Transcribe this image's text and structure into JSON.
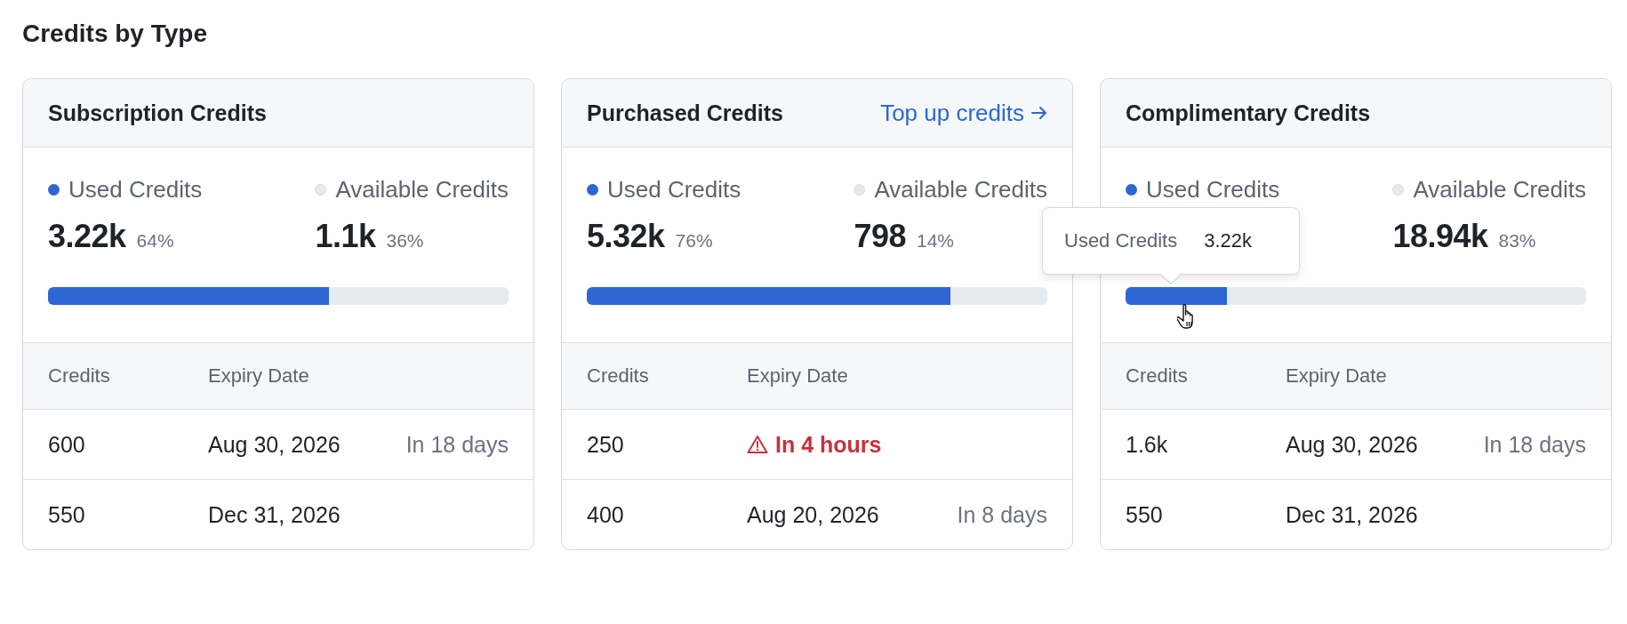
{
  "title": "Credits by Type",
  "cards": [
    {
      "title": "Subscription Credits",
      "used": {
        "label": "Used Credits",
        "value": "3.22k",
        "percent": "64%"
      },
      "available": {
        "label": "Available Credits",
        "value": "1.1k",
        "percent": "36%"
      },
      "level": 0.61,
      "columns": [
        "Credits",
        "Expiry Date"
      ],
      "rows": [
        {
          "credits": "600",
          "expiry": "Aug 30, 2026",
          "urgent": false,
          "relative": "In 18 days"
        },
        {
          "credits": "550",
          "expiry": "Dec 31, 2026",
          "urgent": false
        }
      ]
    },
    {
      "title": "Purchased Credits",
      "link": "Top up credits",
      "used": {
        "label": "Used Credits",
        "value": "5.32k",
        "percent": "76%"
      },
      "available": {
        "label": "Available Credits",
        "value": "798",
        "percent": "14%"
      },
      "level": 0.79,
      "columns": [
        "Credits",
        "Expiry Date"
      ],
      "rows": [
        {
          "credits": "250",
          "expiry": "In 4 hours",
          "urgent": true
        },
        {
          "credits": "400",
          "expiry": "Aug 20, 2026",
          "urgent": false,
          "relative": "In 8 days"
        }
      ]
    },
    {
      "title": "Complimentary Credits",
      "used": {
        "label": "Used Credits"
      },
      "available": {
        "label": "Available Credits",
        "value": "18.94k",
        "percent": "83%"
      },
      "level": 0.22,
      "tooltip": {
        "label": "Used Credits",
        "value": "3.22k"
      },
      "columns": [
        "Credits",
        "Expiry Date"
      ],
      "rows": [
        {
          "credits": "1.6k",
          "expiry": "Aug 30, 2026",
          "urgent": false,
          "relative": "In 18 days"
        },
        {
          "credits": "550",
          "expiry": "Dec 31, 2026",
          "urgent": false
        }
      ]
    }
  ]
}
